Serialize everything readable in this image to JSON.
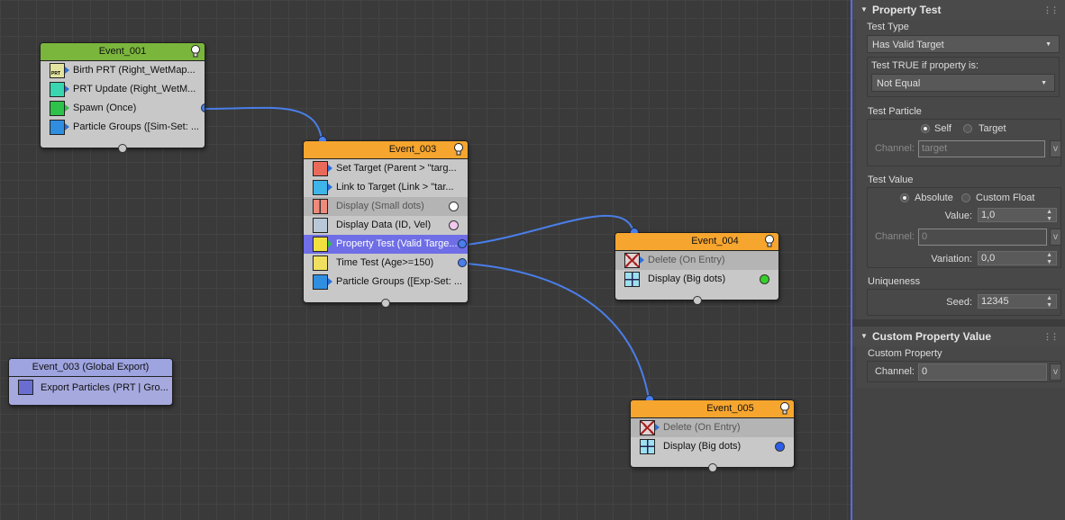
{
  "nodes": {
    "event001": {
      "title": "Event_001",
      "ops": [
        {
          "label": "Birth PRT (Right_WetMap..."
        },
        {
          "label": "PRT Update (Right_WetM..."
        },
        {
          "label": "Spawn (Once)"
        },
        {
          "label": "Particle Groups ([Sim-Set: ..."
        }
      ]
    },
    "event003": {
      "title": "Event_003",
      "ops": [
        {
          "label": "Set Target (Parent > \"targ..."
        },
        {
          "label": "Link to Target (Link > \"tar..."
        },
        {
          "label": "Display (Small dots)",
          "swatch": "#ffffff"
        },
        {
          "label": "Display Data (ID, Vel)",
          "swatch": "#f2c8ee"
        },
        {
          "label": "Property Test (Valid Targe..."
        },
        {
          "label": "Time Test (Age>=150)"
        },
        {
          "label": "Particle Groups ([Exp-Set: ..."
        }
      ]
    },
    "event004": {
      "title": "Event_004",
      "ops": [
        {
          "label": "Delete (On Entry)"
        },
        {
          "label": "Display (Big dots)",
          "swatch": "#36d02c"
        }
      ]
    },
    "event005": {
      "title": "Event_005",
      "ops": [
        {
          "label": "Delete (On Entry)"
        },
        {
          "label": "Display (Big dots)",
          "swatch": "#2e5ee8"
        }
      ]
    },
    "global_export": {
      "title": "Event_003 (Global Export)",
      "ops": [
        {
          "label": "Export Particles (PRT | Gro..."
        }
      ]
    }
  },
  "panel": {
    "property_test": {
      "title": "Property Test",
      "test_type_label": "Test Type",
      "test_type_value": "Has Valid Target",
      "test_true_label": "Test TRUE if property is:",
      "test_true_value": "Not Equal",
      "test_particle_label": "Test Particle",
      "self_label": "Self",
      "target_label": "Target",
      "channel_label": "Channel:",
      "channel_value": "target",
      "v_btn": "v",
      "test_value_label": "Test Value",
      "absolute_label": "Absolute",
      "custom_float_label": "Custom Float",
      "value_label": "Value:",
      "value_value": "1,0",
      "channel2_value": "0",
      "variation_label": "Variation:",
      "variation_value": "0,0",
      "uniqueness_label": "Uniqueness",
      "seed_label": "Seed:",
      "seed_value": "12345"
    },
    "custom_property": {
      "title": "Custom Property Value",
      "group_label": "Custom Property",
      "channel_label": "Channel:",
      "channel_value": "0",
      "v_btn": "v"
    }
  },
  "colors": {
    "header_green": "#7ab63c",
    "header_orange": "#f6a52e",
    "header_purple": "#9ea4e0",
    "wire": "#4a7ee8",
    "selected_row": "#6f6ee6",
    "panel_accent": "#5d67ea"
  }
}
